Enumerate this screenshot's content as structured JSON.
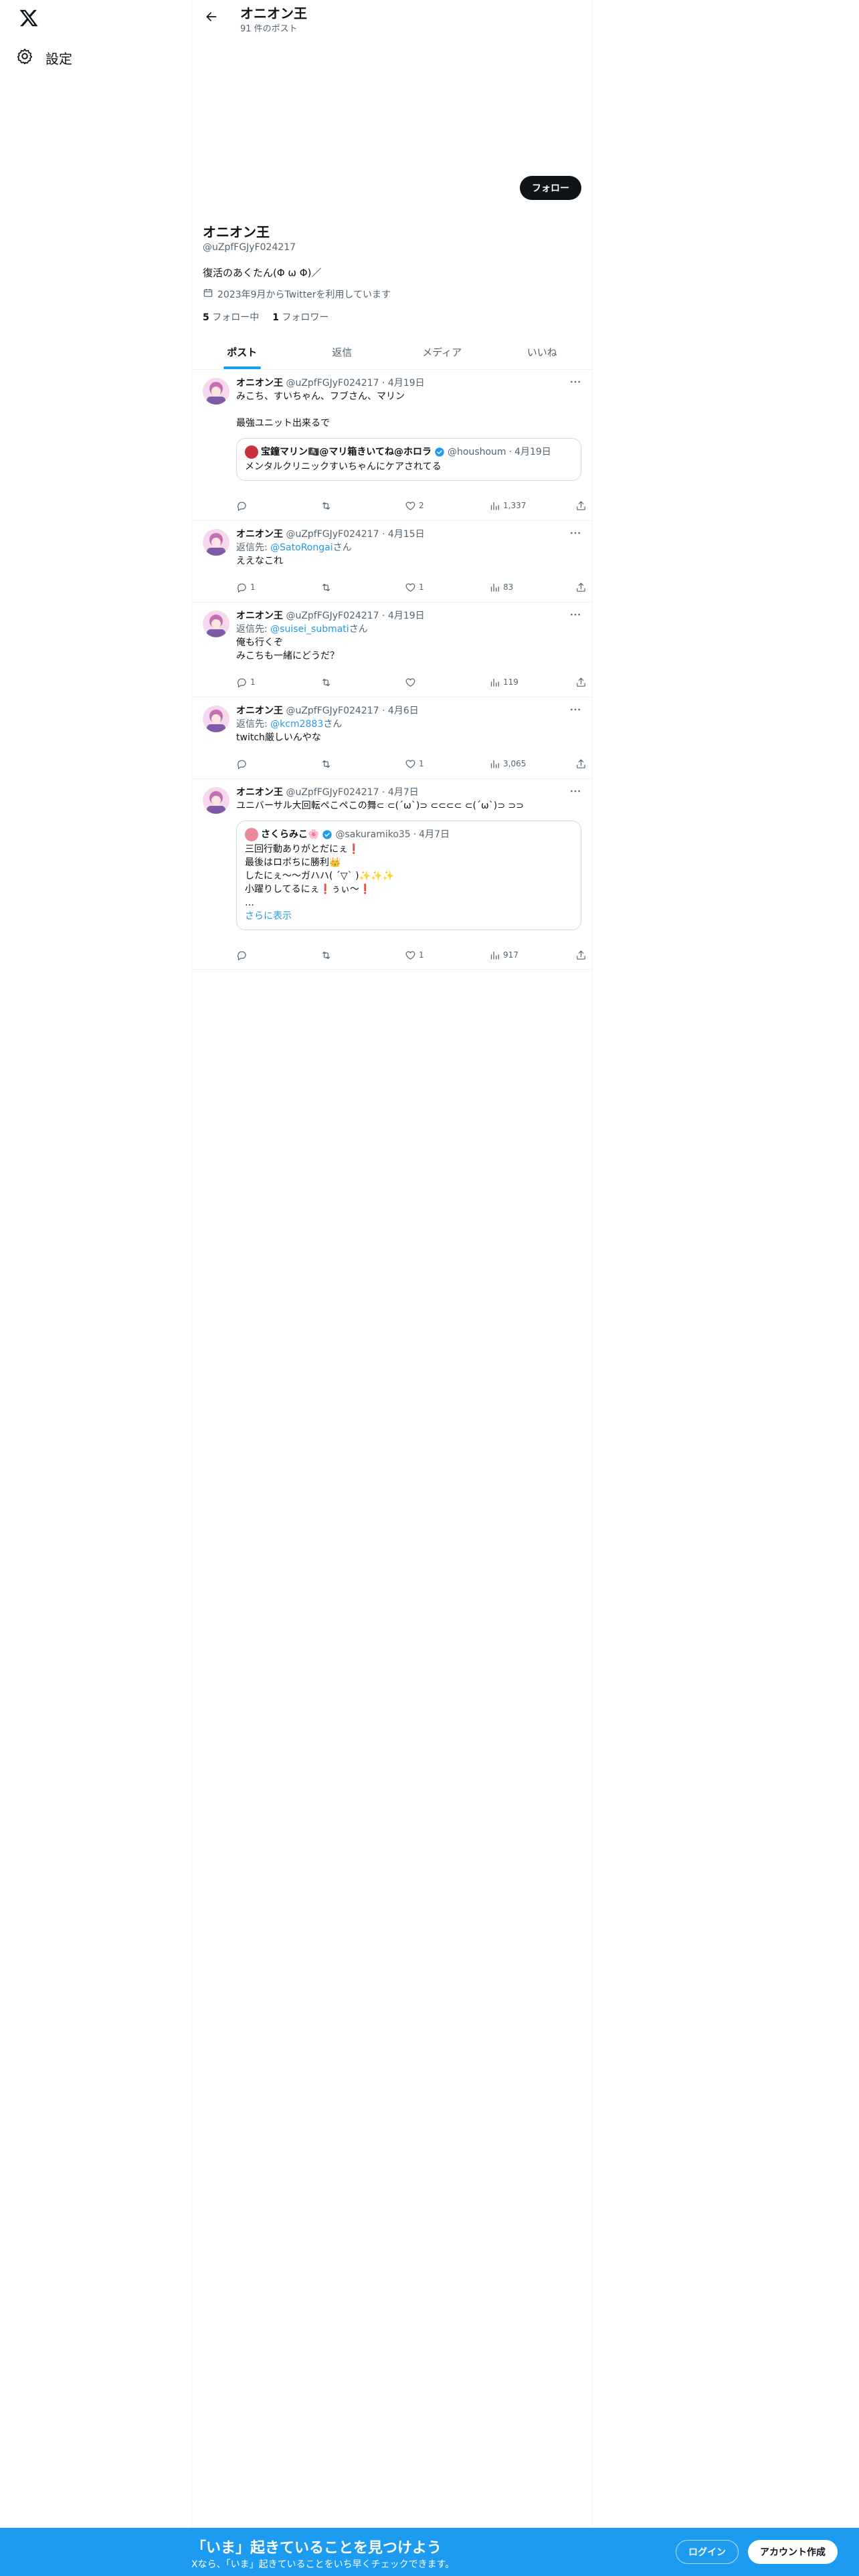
{
  "nav": {
    "logo_icon": "x-logo-icon",
    "settings_label": "設定"
  },
  "header": {
    "name": "オニオン王",
    "post_count": "91 件のポスト"
  },
  "profile": {
    "name": "オニオン王",
    "handle": "@uZpfFGJyF024217",
    "bio": "復活のあくたん(Φ ω Φ)／",
    "joined": "2023年9月からTwitterを利用しています",
    "following_count": "5",
    "following_label": "フォロー中",
    "followers_count": "1",
    "followers_label": "フォロワー",
    "follow_button": "フォロー"
  },
  "tabs": [
    {
      "label": "ポスト",
      "active": true
    },
    {
      "label": "返信",
      "active": false
    },
    {
      "label": "メディア",
      "active": false
    },
    {
      "label": "いいね",
      "active": false
    }
  ],
  "tweets": [
    {
      "name": "オニオン王",
      "handle": "@uZpfFGJyF024217",
      "date": "4月19日",
      "text": "みこち、すいちゃん、フブさん、マリン\n\n最強ユニット出来るで",
      "quote": {
        "name": "宝鐘マリン🏴‍☠️@マリ箱きいてね@ホロラ",
        "handle": "@houshoum",
        "date": "4月19日",
        "text": "メンタルクリニックすいちゃんにケアされてる"
      },
      "replies": "",
      "retweets": "",
      "likes": "2",
      "views": "1,337"
    },
    {
      "name": "オニオン王",
      "handle": "@uZpfFGJyF024217",
      "date": "4月15日",
      "reply_prefix": "返信先: ",
      "reply_to": "@SatoRongai",
      "reply_suffix": "さん",
      "text": "ええなこれ",
      "replies": "1",
      "retweets": "",
      "likes": "1",
      "views": "83"
    },
    {
      "name": "オニオン王",
      "handle": "@uZpfFGJyF024217",
      "date": "4月19日",
      "reply_prefix": "返信先: ",
      "reply_to": "@suisei_submati",
      "reply_suffix": "さん",
      "text": "俺も行くぞ\nみこちも一緒にどうだ？",
      "replies": "1",
      "retweets": "",
      "likes": "",
      "views": "119"
    },
    {
      "name": "オニオン王",
      "handle": "@uZpfFGJyF024217",
      "date": "4月6日",
      "reply_prefix": "返信先: ",
      "reply_to": "@kcm2883",
      "reply_suffix": "さん",
      "text": "twitch厳しいんやな",
      "replies": "",
      "retweets": "",
      "likes": "1",
      "views": "3,065"
    },
    {
      "name": "オニオン王",
      "handle": "@uZpfFGJyF024217",
      "date": "4月7日",
      "text": "ユニバーサル大回転ペこペこの舞⊂ ⊂(´ω`)⊃ ⊂⊂⊂⊂ ⊂(´ω`)⊃ ⊃⊃",
      "quote": {
        "name": "さくらみこ🌸",
        "handle": "@sakuramiko35",
        "date": "4月7日",
        "text": "三回行動ありがとだにぇ❗️\n最後はロボちに勝利👑\nしたにぇ〜〜ガハハ( ˊ▽ˋ )✨✨✨\n小躍りしてるにぇ❗️ぅぃ〜❗️\n…",
        "show_more": "さらに表示"
      },
      "replies": "",
      "retweets": "",
      "likes": "1",
      "views": "917"
    }
  ],
  "bottom_bar": {
    "title": "「いま」起きていることを見つけよう",
    "subtitle": "Xなら、「いま」起きていることをいち早くチェックできます。",
    "login": "ログイン",
    "signup": "アカウント作成"
  },
  "colors": {
    "accent": "#1d9bf0",
    "text": "#0f1419",
    "secondary": "#536471"
  }
}
